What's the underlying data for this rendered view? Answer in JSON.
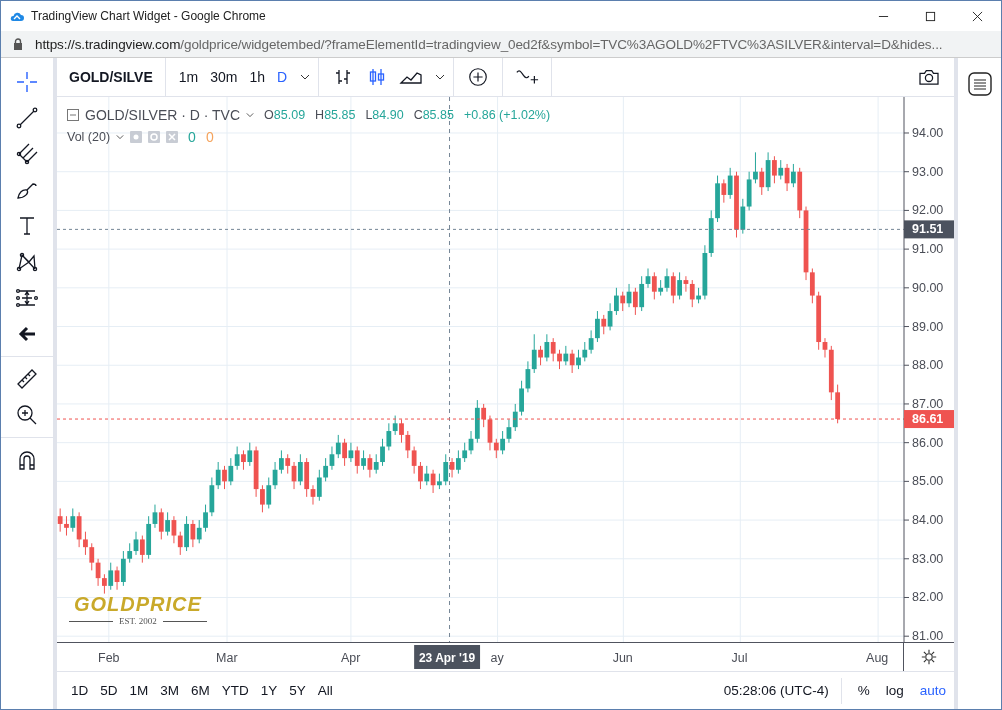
{
  "window": {
    "title": "TradingView Chart Widget - Google Chrome"
  },
  "address_bar": {
    "domain": "https://s.tradingview.com",
    "path": "/goldprice/widgetembed/?frameElementId=tradingview_0ed2f&symbol=TVC%3AGOLD%2FTVC%3ASILVER&interval=D&hides..."
  },
  "left_toolbar": [
    {
      "tools": [
        {
          "kind": "crosshair",
          "selected": true
        },
        {
          "kind": "trend-line",
          "selected": false
        },
        {
          "kind": "fork",
          "selected": false
        },
        {
          "kind": "brush",
          "selected": false
        },
        {
          "kind": "text",
          "selected": false
        },
        {
          "kind": "pattern",
          "selected": false
        },
        {
          "kind": "measure",
          "selected": false
        },
        {
          "kind": "arrow",
          "selected": false
        }
      ]
    },
    {
      "tools": [
        {
          "kind": "ruler",
          "selected": false
        },
        {
          "kind": "zoom",
          "selected": false
        }
      ]
    },
    {
      "tools": [
        {
          "kind": "magnet",
          "selected": false
        }
      ]
    }
  ],
  "toolbar": {
    "symbol": "GOLD/SILVE",
    "intervals": [
      {
        "label": "1m",
        "selected": false
      },
      {
        "label": "30m",
        "selected": false
      },
      {
        "label": "1h",
        "selected": false
      },
      {
        "label": "D",
        "selected": true
      }
    ],
    "chart_styles": [
      {
        "kind": "bars",
        "selected": false
      },
      {
        "kind": "candles",
        "selected": true
      },
      {
        "kind": "area",
        "selected": false
      }
    ]
  },
  "legend": {
    "title": "GOLD/SILVER · D · TVC",
    "ohlc": [
      {
        "key": "O",
        "value": "85.09"
      },
      {
        "key": "H",
        "value": "85.85"
      },
      {
        "key": "L",
        "value": "84.90"
      },
      {
        "key": "C",
        "value": "85.85"
      }
    ],
    "change": "+0.86 (+1.02%)"
  },
  "volume": {
    "label": "Vol (20)",
    "values": [
      {
        "text": "0",
        "color": "#26a69a"
      },
      {
        "text": "0",
        "color": "#f5a35c"
      }
    ]
  },
  "chart_data": {
    "type": "candlestick",
    "yticks": [
      {
        "value": 94,
        "label": "94.00"
      },
      {
        "value": 93,
        "label": "93.00"
      },
      {
        "value": 92,
        "label": "92.00"
      },
      {
        "value": 91,
        "label": "91.00"
      },
      {
        "value": 90,
        "label": "90.00"
      },
      {
        "value": 89,
        "label": "89.00"
      },
      {
        "value": 88,
        "label": "88.00"
      },
      {
        "value": 87,
        "label": "87.00"
      },
      {
        "value": 86,
        "label": "86.00"
      },
      {
        "value": 85,
        "label": "85.00"
      },
      {
        "value": 84,
        "label": "84.00"
      },
      {
        "value": 83,
        "label": "83.00"
      },
      {
        "value": 82,
        "label": "82.00"
      },
      {
        "value": 81,
        "label": "81.00"
      }
    ],
    "ylim": [
      80.85,
      94.93
    ],
    "grid": true,
    "ref_lines": [
      {
        "axis": "y",
        "value": 91.51,
        "label": "91.51",
        "color": "#758696"
      },
      {
        "axis": "y",
        "value": 86.61,
        "label": "86.61",
        "color": "#ef5350"
      }
    ],
    "categories": [
      null,
      null,
      null,
      null,
      null,
      null,
      null,
      null,
      null,
      null,
      null,
      null,
      null,
      null,
      null,
      null,
      null,
      null,
      null,
      null,
      null,
      null,
      null,
      null,
      null,
      null,
      null,
      null,
      null,
      null,
      null,
      null,
      null,
      null,
      null,
      null,
      null,
      null,
      null,
      null,
      null,
      null,
      null,
      null,
      null,
      null,
      null,
      null,
      null,
      null,
      null,
      null,
      null,
      null,
      null,
      null,
      null,
      null,
      null,
      null,
      null,
      null,
      null,
      null,
      null,
      null,
      null,
      null,
      null,
      null,
      null,
      null,
      null,
      null,
      null,
      null,
      null,
      null,
      null,
      null,
      null,
      null,
      null,
      null,
      null,
      null,
      null,
      null,
      null,
      null,
      null,
      null,
      null,
      null,
      null,
      null,
      null,
      null,
      null,
      null,
      null,
      null,
      null,
      null,
      null,
      null,
      null,
      null,
      null,
      null,
      null,
      null,
      null,
      null,
      null,
      null,
      null,
      null,
      null,
      null,
      null,
      null,
      null,
      null,
      null,
      null,
      null,
      null,
      null,
      null,
      null,
      null,
      null,
      null
    ],
    "ohlc": [
      [
        84.1,
        84.3,
        83.7,
        83.9
      ],
      [
        83.9,
        84.1,
        83.6,
        83.8
      ],
      [
        83.8,
        84.3,
        83.7,
        84.1
      ],
      [
        84.1,
        84.2,
        83.3,
        83.5
      ],
      [
        83.5,
        83.7,
        83.1,
        83.3
      ],
      [
        83.3,
        83.4,
        82.7,
        82.9
      ],
      [
        82.9,
        83.0,
        82.3,
        82.5
      ],
      [
        82.5,
        82.6,
        82.1,
        82.3
      ],
      [
        82.3,
        82.9,
        82.2,
        82.7
      ],
      [
        82.7,
        82.8,
        82.2,
        82.4
      ],
      [
        82.4,
        83.2,
        82.3,
        83.0
      ],
      [
        83.0,
        83.4,
        82.9,
        83.2
      ],
      [
        83.2,
        83.7,
        83.1,
        83.5
      ],
      [
        83.5,
        83.6,
        82.9,
        83.1
      ],
      [
        83.1,
        84.1,
        83.0,
        83.9
      ],
      [
        83.9,
        84.4,
        83.8,
        84.2
      ],
      [
        84.2,
        84.3,
        83.5,
        83.7
      ],
      [
        83.7,
        84.2,
        83.6,
        84.0
      ],
      [
        84.0,
        84.1,
        83.4,
        83.6
      ],
      [
        83.6,
        83.7,
        83.1,
        83.3
      ],
      [
        83.3,
        84.1,
        83.2,
        83.9
      ],
      [
        83.9,
        84.0,
        83.3,
        83.5
      ],
      [
        83.5,
        84.0,
        83.4,
        83.8
      ],
      [
        83.8,
        84.4,
        83.7,
        84.2
      ],
      [
        84.2,
        85.1,
        84.1,
        84.9
      ],
      [
        84.9,
        85.5,
        84.8,
        85.3
      ],
      [
        85.3,
        85.4,
        84.8,
        85.0
      ],
      [
        85.0,
        85.6,
        84.9,
        85.4
      ],
      [
        85.4,
        85.9,
        85.3,
        85.7
      ],
      [
        85.7,
        85.8,
        85.3,
        85.5
      ],
      [
        85.5,
        86.0,
        85.4,
        85.8
      ],
      [
        85.8,
        85.9,
        84.6,
        84.8
      ],
      [
        84.8,
        84.9,
        84.2,
        84.4
      ],
      [
        84.4,
        85.1,
        84.3,
        84.9
      ],
      [
        84.9,
        85.5,
        84.8,
        85.3
      ],
      [
        85.3,
        85.8,
        85.2,
        85.6
      ],
      [
        85.6,
        85.7,
        85.2,
        85.4
      ],
      [
        85.4,
        85.5,
        84.8,
        85.0
      ],
      [
        85.0,
        85.7,
        84.9,
        85.5
      ],
      [
        85.5,
        85.6,
        84.6,
        84.8
      ],
      [
        84.8,
        84.9,
        84.4,
        84.6
      ],
      [
        84.6,
        85.3,
        84.5,
        85.1
      ],
      [
        85.1,
        85.6,
        85.0,
        85.4
      ],
      [
        85.4,
        85.9,
        85.3,
        85.7
      ],
      [
        85.7,
        86.2,
        85.6,
        86.0
      ],
      [
        86.0,
        86.1,
        85.4,
        85.6
      ],
      [
        85.6,
        86.0,
        85.5,
        85.8
      ],
      [
        85.8,
        85.9,
        85.2,
        85.4
      ],
      [
        85.4,
        85.8,
        85.3,
        85.6
      ],
      [
        85.6,
        85.7,
        85.1,
        85.3
      ],
      [
        85.3,
        85.7,
        85.2,
        85.5
      ],
      [
        85.5,
        86.1,
        85.4,
        85.9
      ],
      [
        85.9,
        86.5,
        85.8,
        86.3
      ],
      [
        86.3,
        86.7,
        86.2,
        86.5
      ],
      [
        86.5,
        86.6,
        86.0,
        86.2
      ],
      [
        86.2,
        86.3,
        85.6,
        85.8
      ],
      [
        85.8,
        85.9,
        85.2,
        85.4
      ],
      [
        85.4,
        85.5,
        84.8,
        85.0
      ],
      [
        85.0,
        85.4,
        84.9,
        85.2
      ],
      [
        85.2,
        85.3,
        84.7,
        84.9
      ],
      [
        84.9,
        85.2,
        84.8,
        85.0
      ],
      [
        85.0,
        85.7,
        84.9,
        85.5
      ],
      [
        85.5,
        85.6,
        85.1,
        85.3
      ],
      [
        85.3,
        85.8,
        85.2,
        85.6
      ],
      [
        85.6,
        86.0,
        85.5,
        85.8
      ],
      [
        85.8,
        86.3,
        85.7,
        86.1
      ],
      [
        86.1,
        87.1,
        86.0,
        86.9
      ],
      [
        86.9,
        87.0,
        86.4,
        86.6
      ],
      [
        86.6,
        86.7,
        85.8,
        86.0
      ],
      [
        86.0,
        86.1,
        85.6,
        85.8
      ],
      [
        85.8,
        86.3,
        85.7,
        86.1
      ],
      [
        86.1,
        86.6,
        86.0,
        86.4
      ],
      [
        86.4,
        87.0,
        86.3,
        86.8
      ],
      [
        86.8,
        87.6,
        86.7,
        87.4
      ],
      [
        87.4,
        88.1,
        87.3,
        87.9
      ],
      [
        87.9,
        88.8,
        87.8,
        88.4
      ],
      [
        88.4,
        88.5,
        88.0,
        88.2
      ],
      [
        88.2,
        88.8,
        88.1,
        88.6
      ],
      [
        88.6,
        88.7,
        88.1,
        88.3
      ],
      [
        88.3,
        88.4,
        87.9,
        88.1
      ],
      [
        88.1,
        88.5,
        88.0,
        88.3
      ],
      [
        88.3,
        88.4,
        87.8,
        88.0
      ],
      [
        88.0,
        88.4,
        87.9,
        88.2
      ],
      [
        88.2,
        88.6,
        88.1,
        88.4
      ],
      [
        88.4,
        88.9,
        88.3,
        88.7
      ],
      [
        88.7,
        89.4,
        88.6,
        89.2
      ],
      [
        89.2,
        89.3,
        88.8,
        89.0
      ],
      [
        89.0,
        89.6,
        88.9,
        89.4
      ],
      [
        89.4,
        90.0,
        89.3,
        89.8
      ],
      [
        89.8,
        89.9,
        89.4,
        89.6
      ],
      [
        89.6,
        90.1,
        89.5,
        89.9
      ],
      [
        89.9,
        90.0,
        89.3,
        89.5
      ],
      [
        89.5,
        90.3,
        89.4,
        90.1
      ],
      [
        90.1,
        90.5,
        90.0,
        90.3
      ],
      [
        90.3,
        90.4,
        89.7,
        89.9
      ],
      [
        89.9,
        90.2,
        89.8,
        90.0
      ],
      [
        90.0,
        90.5,
        89.9,
        90.3
      ],
      [
        90.3,
        90.4,
        89.6,
        89.8
      ],
      [
        89.8,
        90.4,
        89.7,
        90.2
      ],
      [
        90.2,
        90.3,
        89.9,
        90.1
      ],
      [
        90.1,
        90.2,
        89.5,
        89.7
      ],
      [
        89.7,
        90.0,
        89.6,
        89.8
      ],
      [
        89.8,
        91.1,
        89.7,
        90.9
      ],
      [
        90.9,
        92.0,
        90.8,
        91.8
      ],
      [
        91.8,
        92.9,
        91.7,
        92.7
      ],
      [
        92.7,
        92.8,
        92.2,
        92.4
      ],
      [
        92.4,
        93.1,
        92.3,
        92.9
      ],
      [
        92.9,
        93.0,
        91.3,
        91.5
      ],
      [
        91.5,
        92.3,
        91.4,
        92.1
      ],
      [
        92.1,
        93.0,
        92.0,
        92.8
      ],
      [
        92.8,
        93.5,
        92.7,
        93.0
      ],
      [
        93.0,
        93.1,
        92.4,
        92.6
      ],
      [
        92.6,
        93.5,
        92.5,
        93.3
      ],
      [
        93.3,
        93.4,
        92.7,
        92.9
      ],
      [
        92.9,
        93.3,
        92.8,
        93.1
      ],
      [
        93.1,
        93.2,
        92.5,
        92.7
      ],
      [
        92.7,
        93.2,
        92.6,
        93.0
      ],
      [
        93.0,
        93.1,
        91.8,
        92.0
      ],
      [
        92.0,
        92.1,
        90.2,
        90.4
      ],
      [
        90.4,
        90.5,
        89.6,
        89.8
      ],
      [
        89.8,
        89.9,
        88.4,
        88.6
      ],
      [
        88.6,
        88.7,
        88.2,
        88.4
      ],
      [
        88.4,
        88.5,
        87.1,
        87.3
      ],
      [
        87.3,
        87.5,
        86.5,
        86.61
      ],
      null,
      null,
      null,
      null,
      null,
      null,
      null,
      null,
      null,
      null
    ]
  },
  "time_axis": {
    "labels": [
      "Feb",
      "Mar",
      "Apr",
      "ay",
      "Jun",
      "Jul",
      "Aug"
    ],
    "crosshair_label": "23 Apr '19"
  },
  "logo": {
    "name": "GOLDPRICE",
    "tagline": "EST. 2002"
  },
  "ranges": [
    "1D",
    "5D",
    "1M",
    "3M",
    "6M",
    "YTD",
    "1Y",
    "5Y",
    "All"
  ],
  "clock": "05:28:06 (UTC-4)",
  "scale_buttons": [
    {
      "label": "%",
      "selected": false
    },
    {
      "label": "log",
      "selected": false
    },
    {
      "label": "auto",
      "selected": true
    }
  ]
}
